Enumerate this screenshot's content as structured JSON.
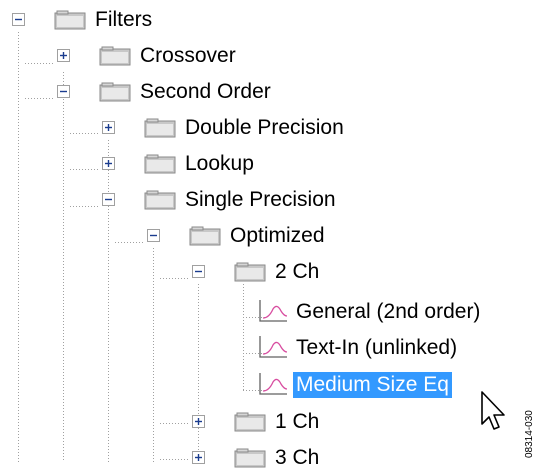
{
  "tree": {
    "nodes": [
      {
        "label": "Filters",
        "state": "expanded",
        "kind": "folder",
        "depth": 0
      },
      {
        "label": "Crossover",
        "state": "collapsed",
        "kind": "folder",
        "depth": 1
      },
      {
        "label": "Second Order",
        "state": "expanded",
        "kind": "folder",
        "depth": 1
      },
      {
        "label": "Double Precision",
        "state": "collapsed",
        "kind": "folder",
        "depth": 2
      },
      {
        "label": "Lookup",
        "state": "collapsed",
        "kind": "folder",
        "depth": 2
      },
      {
        "label": "Single Precision",
        "state": "expanded",
        "kind": "folder",
        "depth": 2
      },
      {
        "label": "Optimized",
        "state": "expanded",
        "kind": "folder",
        "depth": 3
      },
      {
        "label": "2 Ch",
        "state": "expanded",
        "kind": "folder",
        "depth": 4
      },
      {
        "label": "General (2nd order)",
        "kind": "leaf",
        "depth": 5
      },
      {
        "label": "Text-In (unlinked)",
        "kind": "leaf",
        "depth": 5
      },
      {
        "label": "Medium Size Eq",
        "kind": "leaf",
        "depth": 5,
        "selected": true
      },
      {
        "label": "1 Ch",
        "state": "collapsed",
        "kind": "folder",
        "depth": 4
      },
      {
        "label": "3 Ch",
        "state": "collapsed",
        "kind": "folder",
        "depth": 4
      }
    ]
  },
  "colors": {
    "selection": "#3399ff",
    "guide": "#a0a0a0"
  },
  "figure_id": "08314-030"
}
